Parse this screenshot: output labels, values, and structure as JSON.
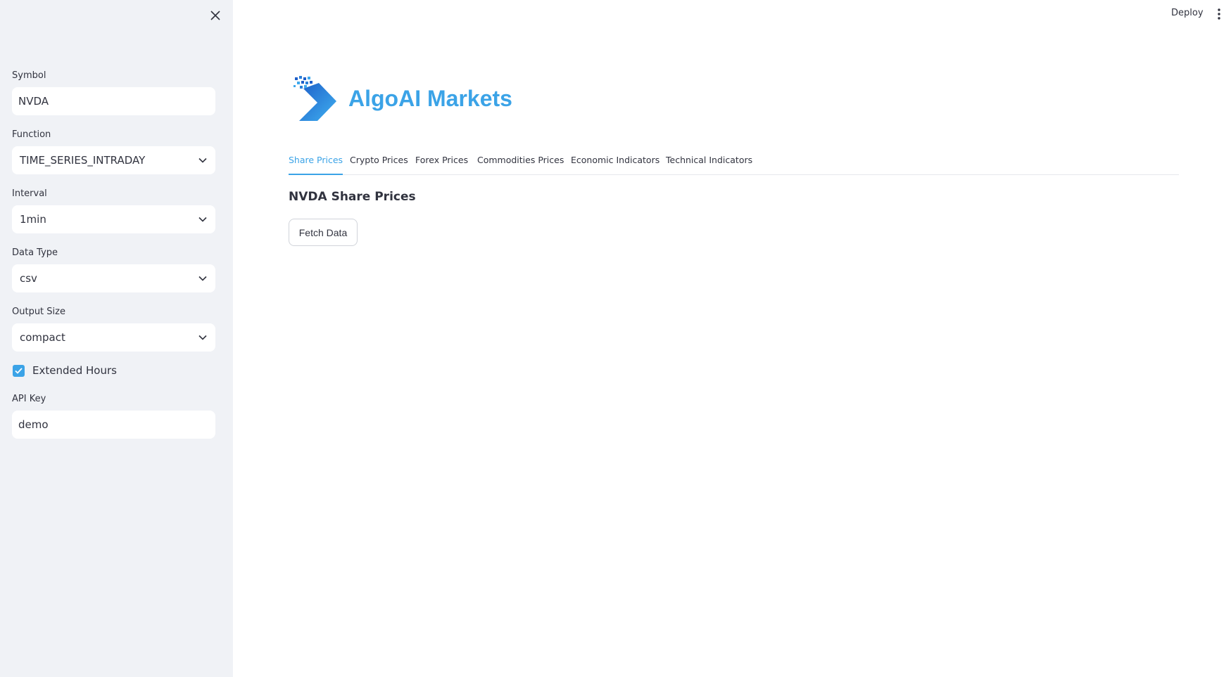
{
  "colors": {
    "accent": "#3ba3e7",
    "sidebar_bg": "#f0f2f6",
    "text": "#31333f"
  },
  "sidebar": {
    "close_icon": "close-icon",
    "symbol": {
      "label": "Symbol",
      "value": "NVDA"
    },
    "function": {
      "label": "Function",
      "value": "TIME_SERIES_INTRADAY"
    },
    "interval": {
      "label": "Interval",
      "value": "1min"
    },
    "data_type": {
      "label": "Data Type",
      "value": "csv"
    },
    "output_size": {
      "label": "Output Size",
      "value": "compact"
    },
    "extended_hours": {
      "label": "Extended Hours",
      "checked": true
    },
    "api_key": {
      "label": "API Key",
      "value": "demo"
    }
  },
  "toolbar": {
    "deploy_label": "Deploy",
    "menu_icon": "kebab-menu-icon"
  },
  "header": {
    "title": "AlgoAI Markets",
    "logo_icon": "algoai-logo-icon"
  },
  "tabs": [
    {
      "label": "Share Prices",
      "active": true
    },
    {
      "label": "Crypto Prices",
      "active": false
    },
    {
      "label": "Forex Prices",
      "active": false
    },
    {
      "label": "Commodities Prices",
      "active": false
    },
    {
      "label": "Economic Indicators",
      "active": false
    },
    {
      "label": "Technical Indicators",
      "active": false
    }
  ],
  "main": {
    "section_title": "NVDA Share Prices",
    "fetch_button_label": "Fetch Data"
  }
}
